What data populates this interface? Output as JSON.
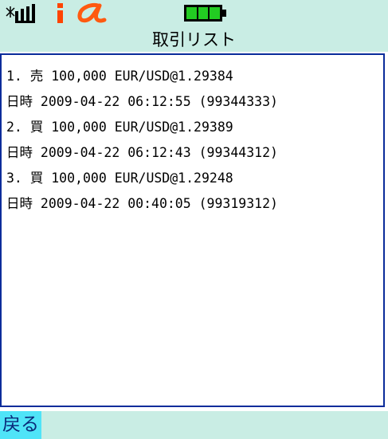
{
  "header": {
    "title": "取引リスト"
  },
  "trades": [
    {
      "line": "1. 売 100,000 EUR/USD@1.29384"
    },
    {
      "line": "日時 2009-04-22 06:12:55 (99344333)"
    },
    {
      "line": "2. 買 100,000 EUR/USD@1.29389"
    },
    {
      "line": "日時 2009-04-22 06:12:43 (99344312)"
    },
    {
      "line": "3. 買 100,000 EUR/USD@1.29248"
    },
    {
      "line": "日時 2009-04-22 00:40:05 (99319312)"
    }
  ],
  "softkeys": {
    "back_label": "戻る"
  },
  "status": {
    "signal_icon": "signal-strength-icon",
    "info_icon": "i-mode-icon",
    "alpha_icon": "alpha-icon",
    "battery_icon": "battery-icon",
    "battery_level": 1.0
  },
  "colors": {
    "bar_background": "#c9ede4",
    "list_border": "#0a2c9a",
    "softkey_highlight": "#4fe4f8",
    "battery_fill": "#22cc22",
    "alpha_icon": "#ff5a10",
    "info_icon": "#ff4400"
  }
}
